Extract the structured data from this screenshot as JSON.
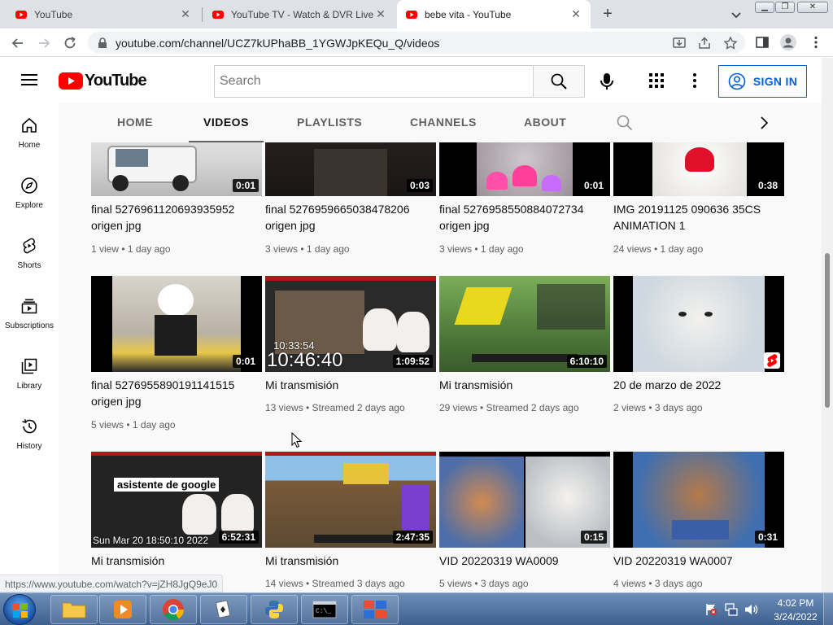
{
  "browser": {
    "tabs": [
      {
        "title": "YouTube",
        "active": false
      },
      {
        "title": "YouTube TV - Watch & DVR Live",
        "active": false
      },
      {
        "title": "bebe vita - YouTube",
        "active": true
      }
    ],
    "url": "youtube.com/channel/UCZ7kUPhaBB_1YGWJpKEQu_Q/videos",
    "status_url": "https://www.youtube.com/watch?v=jZH8JgQ9eJ0"
  },
  "masthead": {
    "logo_text": "YouTube",
    "search_placeholder": "Search",
    "signin_label": "SIGN IN"
  },
  "guide": {
    "items": [
      {
        "label": "Home",
        "icon": "home-icon"
      },
      {
        "label": "Explore",
        "icon": "compass-icon"
      },
      {
        "label": "Shorts",
        "icon": "shorts-icon"
      },
      {
        "label": "Subscriptions",
        "icon": "subscriptions-icon"
      },
      {
        "label": "Library",
        "icon": "library-icon"
      },
      {
        "label": "History",
        "icon": "history-icon"
      }
    ]
  },
  "channel_tabs": [
    "HOME",
    "VIDEOS",
    "PLAYLISTS",
    "CHANNELS",
    "ABOUT"
  ],
  "selected_tab": "VIDEOS",
  "videos": [
    {
      "title": "final 5276961120693935952 origen jpg",
      "meta": "1 view • 1 day ago",
      "duration": "0:01"
    },
    {
      "title": "final 5276959665038478206 origen jpg",
      "meta": "3 views • 1 day ago",
      "duration": "0:03"
    },
    {
      "title": "final 5276958550884072734 origen jpg",
      "meta": "3 views • 1 day ago",
      "duration": "0:01"
    },
    {
      "title": "IMG 20191125 090636 35CS ANIMATION 1",
      "meta": "24 views • 1 day ago",
      "duration": "0:38"
    },
    {
      "title": "final 5276955890191141515 origen jpg",
      "meta": "5 views • 1 day ago",
      "duration": "0:01"
    },
    {
      "title": "Mi transmisión",
      "meta": "13 views • Streamed 2 days ago",
      "duration": "1:09:52",
      "overlay_small": "10:33:54",
      "overlay_big": "10:46:40"
    },
    {
      "title": "Mi transmisión",
      "meta": "29 views • Streamed 2 days ago",
      "duration": "6:10:10"
    },
    {
      "title": "20 de marzo de 2022",
      "meta": "2 views • 3 days ago",
      "duration": ""
    },
    {
      "title": "Mi transmisión",
      "meta": "",
      "duration": "6:52:31",
      "overlay_banner": "asistente de google",
      "overlay_bottom": "Sun Mar 20 18:50:10 2022"
    },
    {
      "title": "Mi transmisión",
      "meta": "14 views • Streamed 3 days ago",
      "duration": "2:47:35"
    },
    {
      "title": "VID 20220319 WA0009",
      "meta": "5 views • 3 days ago",
      "duration": "0:15"
    },
    {
      "title": "VID 20220319 WA0007",
      "meta": "4 views • 3 days ago",
      "duration": "0:31"
    }
  ],
  "taskbar": {
    "time": "4:02 PM",
    "date": "3/24/2022"
  },
  "colors": {
    "youtube_red": "#ff0000",
    "signin_blue": "#065fd4",
    "meta_gray": "#606060"
  }
}
